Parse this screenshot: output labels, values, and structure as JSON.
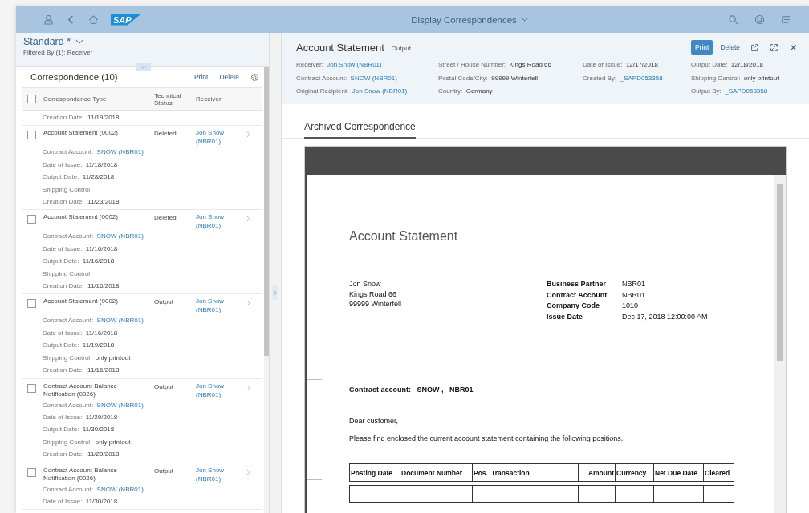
{
  "shell": {
    "logo": "SAP",
    "title": "Display Correspondences"
  },
  "left": {
    "variant": "Standard *",
    "filter": "Filtered By (1): Receiver",
    "list_title": "Correspondence (10)",
    "actions": [
      "Print",
      "Delete"
    ],
    "select_all": {
      "checked": false
    },
    "columns": [
      "Correspondence Type",
      "Technical Status",
      "Receiver"
    ],
    "partial_lines": [
      {
        "label": "Creation Date:",
        "value": "11/19/2018",
        "kind": "text"
      }
    ],
    "items": [
      {
        "type": "Account Statement (0002)",
        "status": "Deleted",
        "receiver": "Jon Snow (NBR01)",
        "checked": false,
        "details": [
          {
            "label": "Contract Account:",
            "value": "SNOW (NBR01)",
            "kind": "link"
          },
          {
            "label": "Date of Issue:",
            "value": "11/18/2018",
            "kind": "text"
          },
          {
            "label": "Output Date:",
            "value": "11/28/2018",
            "kind": "text"
          },
          {
            "label": "Shipping Control:"
          },
          {
            "label": "Creation Date:",
            "value": "11/23/2018",
            "kind": "text"
          }
        ]
      },
      {
        "type": "Account Statement (0002)",
        "status": "Deleted",
        "receiver": "Jon Snow (NBR01)",
        "checked": false,
        "details": [
          {
            "label": "Contract Account:",
            "value": "SNOW (NBR01)",
            "kind": "link"
          },
          {
            "label": "Date of Issue:",
            "value": "11/16/2018",
            "kind": "text"
          },
          {
            "label": "Output Date:",
            "value": "11/16/2018",
            "kind": "text"
          },
          {
            "label": "Shipping Control:"
          },
          {
            "label": "Creation Date:",
            "value": "11/16/2018",
            "kind": "text"
          }
        ]
      },
      {
        "type": "Account Statement (0002)",
        "status": "Output",
        "receiver": "Jon Snow (NBR01)",
        "checked": false,
        "details": [
          {
            "label": "Contract Account:",
            "value": "SNOW (NBR01)",
            "kind": "link"
          },
          {
            "label": "Date of Issue:",
            "value": "11/16/2018",
            "kind": "text"
          },
          {
            "label": "Output Date:",
            "value": "11/19/2018",
            "kind": "text"
          },
          {
            "label": "Shipping Control:",
            "value": "only printout",
            "kind": "text"
          },
          {
            "label": "Creation Date:",
            "value": "11/16/2018",
            "kind": "text"
          }
        ]
      },
      {
        "type": "Contract Account Balance Notification (0026)",
        "status": "Output",
        "receiver": "Jon Snow (NBR01)",
        "checked": false,
        "details": [
          {
            "label": "Contract Account:",
            "value": "SNOW (NBR01)",
            "kind": "link"
          },
          {
            "label": "Date of Issue:",
            "value": "11/29/2018",
            "kind": "text"
          },
          {
            "label": "Output Date:",
            "value": "11/30/2018",
            "kind": "text"
          },
          {
            "label": "Shipping Control:",
            "value": "only printout",
            "kind": "text"
          },
          {
            "label": "Creation Date:",
            "value": "11/29/2018",
            "kind": "text"
          }
        ]
      },
      {
        "type": "Contract Account Balance Notification (0026)",
        "status": "Output",
        "receiver": "Jon Snow (NBR01)",
        "checked": false,
        "details": [
          {
            "label": "Contract Account:",
            "value": "SNOW (NBR01)",
            "kind": "link"
          },
          {
            "label": "Date of Issue:",
            "value": "11/30/2018",
            "kind": "text"
          }
        ]
      }
    ]
  },
  "detail": {
    "title": "Account Statement",
    "status": "Output",
    "actions": [
      {
        "label": "Print",
        "kind": "primary"
      },
      {
        "label": "Delete",
        "kind": "plain"
      }
    ],
    "fields": [
      [
        {
          "label": "Receiver:",
          "value": "Jon Snow (NBR01)",
          "kind": "link"
        },
        {
          "label": "Contract Account:",
          "value": "SNOW (NBR01)",
          "kind": "link"
        },
        {
          "label": "Original Recipient:",
          "value": "Jon Snow (NBR01)",
          "kind": "link"
        }
      ],
      [
        {
          "label": "Street / House Number:",
          "value": "Kings Road 66",
          "kind": "text"
        },
        {
          "label": "Postal Code/City:",
          "value": "99999 Winterfell",
          "kind": "text"
        },
        {
          "label": "Country:",
          "value": "Germany",
          "kind": "text"
        }
      ],
      [
        {
          "label": "Date of Issue:",
          "value": "12/17/2018",
          "kind": "text"
        },
        {
          "label": "Created By:",
          "value": "_SAPD053358",
          "kind": "link"
        }
      ],
      [
        {
          "label": "Output Date:",
          "value": "12/18/2018",
          "kind": "text"
        },
        {
          "label": "Shipping Control:",
          "value": "only printout",
          "kind": "text"
        },
        {
          "label": "Output By:",
          "value": "_SAPD053358",
          "kind": "link"
        }
      ]
    ],
    "tab": {
      "label": "Archived Correspondence",
      "selected": true
    }
  },
  "document": {
    "title": "Account Statement",
    "address": [
      "Jon Snow",
      "Kings Road 66",
      "99999 Winterfell"
    ],
    "info": [
      {
        "label": "Business Partner",
        "value": "NBR01"
      },
      {
        "label": "Contract Account",
        "value": "NBR01"
      },
      {
        "label": "Company Code",
        "value": "1010"
      },
      {
        "label": "Issue Date",
        "value": "Dec 17, 2018 12:00:00 AM"
      }
    ],
    "contract_line": "Contract account:   SNOW ,   NBR01",
    "greeting": "Dear customer,",
    "body": "Please find enclosed the current account statement containing the following positions.",
    "table": {
      "columns": [
        "Posting Date",
        "Document Number",
        "Pos.",
        "Transaction",
        "Amount",
        "Currency",
        "Net Due Date",
        "Cleared"
      ]
    }
  }
}
